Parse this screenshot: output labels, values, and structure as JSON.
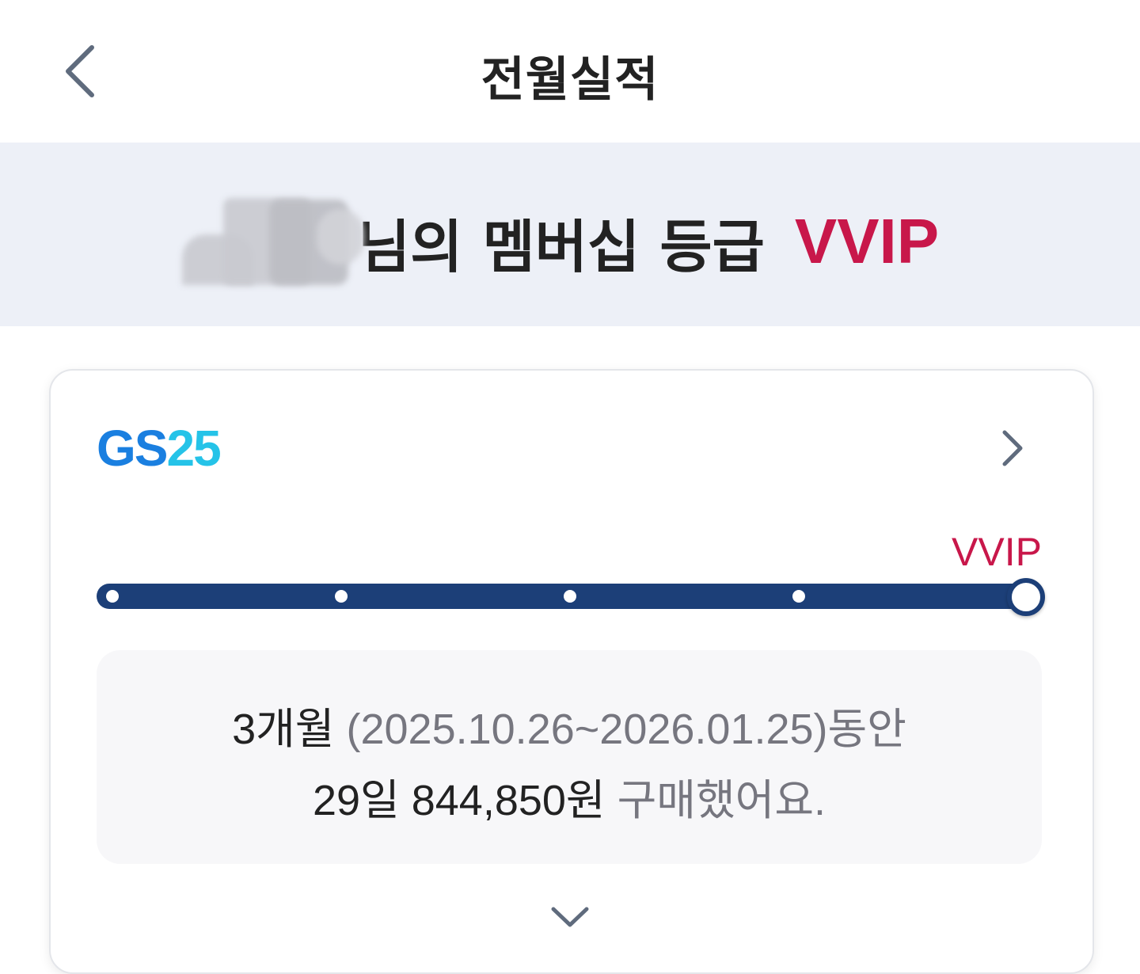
{
  "header": {
    "title": "전월실적",
    "back_icon": "chevron-left-icon"
  },
  "banner": {
    "text": "님의 멤버십 등급",
    "grade": "VVIP",
    "grade_color": "#c8174a"
  },
  "card": {
    "brand": {
      "part1": "GS",
      "part2": "25"
    },
    "arrow_icon": "chevron-right-icon",
    "current_grade_label": "VVIP",
    "progress": {
      "steps": 5,
      "current_step": 5
    },
    "summary": {
      "period_label": "3개월",
      "period_range": "(2025.10.26~2026.01.25)",
      "period_suffix": "동안",
      "days": "29일",
      "amount": "844,850원",
      "amount_suffix": "구매했어요."
    },
    "expand_icon": "chevron-down-icon"
  },
  "colors": {
    "accent": "#c8174a",
    "track": "#1c3f78",
    "banner_bg": "#edf0f7"
  }
}
